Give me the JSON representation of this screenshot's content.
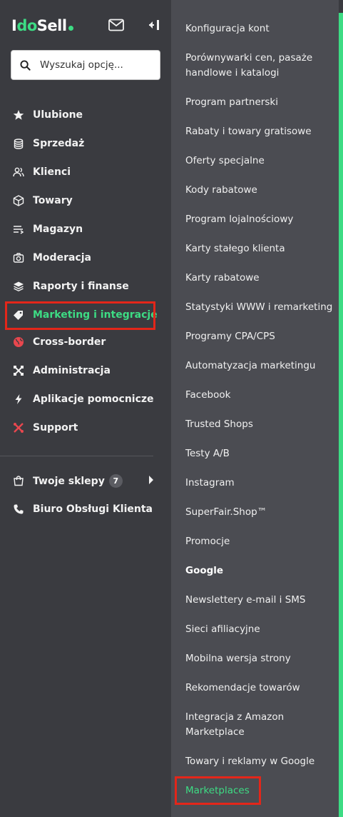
{
  "brand": {
    "logo_prefix": "I",
    "logo_do": "do",
    "logo_suffix": "Sell"
  },
  "search": {
    "placeholder": "Wyszukaj opcję..."
  },
  "nav": {
    "items": [
      {
        "label": "Ulubione",
        "icon": "star-icon"
      },
      {
        "label": "Sprzedaż",
        "icon": "coins-icon"
      },
      {
        "label": "Klienci",
        "icon": "users-icon"
      },
      {
        "label": "Towary",
        "icon": "box-icon"
      },
      {
        "label": "Magazyn",
        "icon": "warehouse-icon"
      },
      {
        "label": "Moderacja",
        "icon": "camera-icon"
      },
      {
        "label": "Raporty i finanse",
        "icon": "layers-icon"
      },
      {
        "label": "Marketing i integracje",
        "icon": "tag-icon",
        "active": true
      },
      {
        "label": "Cross-border",
        "icon": "globe-icon"
      },
      {
        "label": "Administracja",
        "icon": "tools-icon"
      },
      {
        "label": "Aplikacje pomocnicze",
        "icon": "lightning-icon"
      },
      {
        "label": "Support",
        "icon": "support-icon"
      }
    ],
    "shops": {
      "label": "Twoje sklepy",
      "badge": "7",
      "icon": "shop-icon"
    },
    "customer_service": {
      "label": "Biuro Obsługi Klienta",
      "icon": "phone-icon"
    }
  },
  "submenu": {
    "items": [
      {
        "label": "Konfiguracja kont"
      },
      {
        "label": "Porównywarki cen, pasaże handlowe i katalogi"
      },
      {
        "label": "Program partnerski"
      },
      {
        "label": "Rabaty i towary gratisowe"
      },
      {
        "label": "Oferty specjalne"
      },
      {
        "label": "Kody rabatowe"
      },
      {
        "label": "Program lojalnościowy"
      },
      {
        "label": "Karty stałego klienta"
      },
      {
        "label": "Karty rabatowe"
      },
      {
        "label": "Statystyki WWW i remarketing"
      },
      {
        "label": "Programy CPA/CPS"
      },
      {
        "label": "Automatyzacja marketingu"
      },
      {
        "label": "Facebook"
      },
      {
        "label": "Trusted Shops"
      },
      {
        "label": "Testy A/B"
      },
      {
        "label": "Instagram"
      },
      {
        "label": "SuperFair.Shop™"
      },
      {
        "label": "Promocje"
      },
      {
        "label": "Google",
        "bold": true
      },
      {
        "label": "Newslettery e-mail i SMS"
      },
      {
        "label": "Sieci afiliacyjne"
      },
      {
        "label": "Mobilna wersja strony"
      },
      {
        "label": "Rekomendacje towarów"
      },
      {
        "label": "Integracja z Amazon Marketplace"
      },
      {
        "label": "Towary i reklamy w Google"
      },
      {
        "label": "Marketplaces",
        "active": true
      }
    ]
  },
  "colors": {
    "sidebar_bg": "#3a3b40",
    "submenu_bg": "#4b4c52",
    "accent": "#3ddc84",
    "highlight": "#e3261a"
  }
}
